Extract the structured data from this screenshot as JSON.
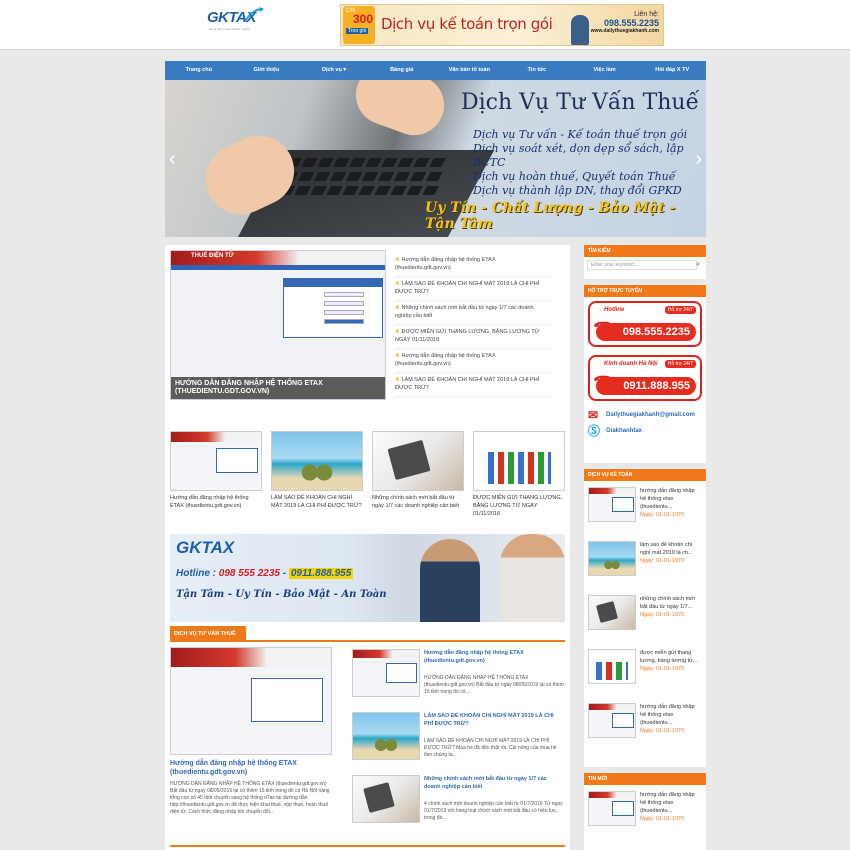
{
  "header": {
    "logo_text": "GKTAX",
    "logo_tagline": "Đồng hành cùng doanh nghiệp",
    "ad": {
      "badge_chi": "Chỉ",
      "badge_num": "300",
      "badge_sub": "Trọn gói",
      "title": "Dịch vụ kế toán trọn gói",
      "contact_label": "Liên hệ:",
      "phone": "098.555.2235",
      "site": "www.dailythuegiakhanh.com"
    }
  },
  "nav": [
    "Trang chủ",
    "Giới thiệu",
    "Dịch vụ ▾",
    "Bảng giá",
    "Văn bản tổ toán",
    "Tin tức",
    "Việc làm",
    "Hỏi đáp X TV"
  ],
  "slider": {
    "title": "Dịch Vụ Tư Vấn Thuế",
    "lines": [
      "Dịch vụ Tư vấn - Kế toán thuế trọn gói",
      "Dịch vụ soát xét, dọn dẹp sổ sách, lập BCTC",
      "Dịch vụ hoàn thuế, Quyết toán Thuế",
      "Dịch vụ thành lập DN, thay đổi GPKD"
    ],
    "tagline": "Uy Tín - Chất Lượng - Bảo Mật - Tận Tâm",
    "prev": "‹",
    "next": "›"
  },
  "feature": {
    "tax_header": "THUẾ ĐIỆN TỬ",
    "caption": "HƯỚNG DẪN ĐĂNG NHẬP HỆ THỐNG ETAX (THUEDIENTU.GDT.GOV.VN)"
  },
  "latest": [
    "Hướng dẫn đăng nhập hệ thống ETAX (thuedientu.gdt.gov.vn)",
    "LÀM SAO ĐỂ KHOẢN CHI NGHỈ MÁT 2019 LÀ CHI PHÍ ĐƯỢC TRỪ?",
    "Những chính sách mới bắt đầu từ ngày 1/7 các doanh nghiệp cần biết",
    "ĐƯỢC MIỄN GỬI THANG LƯƠNG, BẢNG LƯƠNG TỪ NGÀY 01/11/2018",
    "Hướng dẫn đăng nhập hệ thống ETAX (thuedientu.gdt.gov.vn)",
    "LÀM SAO ĐỂ KHOẢN CHI NGHỈ MÁT 2019 LÀ CHI PHÍ ĐƯỢC TRỪ?"
  ],
  "thumbs": [
    "Hướng dẫn đăng nhập hệ thống ETAX (thuedientu.gdt.gov.vn)",
    "LÀM SAO ĐỂ KHOẢN CHI NGHỈ MÁT 2019 LÀ CHI PHÍ ĐƯỢC TRỪ?",
    "Những chính sách mới bắt đầu từ ngày 1/7 các doanh nghiệp cần biết",
    "ĐƯỢC MIỄN GỬI THANG LƯƠNG, BẢNG LƯƠNG TỪ NGÀY 01/11/2018"
  ],
  "promo": {
    "logo": "GKTAX",
    "hotline_label": "Hotline :",
    "hotline_1": "098 555 2235",
    "hotline_2": "0911.888.955",
    "slogan": "Tận Tâm - Uy Tín - Bảo Mật - An Toàn"
  },
  "section": {
    "label": "DỊCH VỤ TƯ VẤN THUẾ",
    "big": {
      "title": "Hướng dẫn đăng nhập hệ thống ETAX (thuedientu.gdt.gov.vn)",
      "desc": "HƯỚNG DẪN ĐĂNG NHẬP HỆ THỐNG ETAX (thuedientu.gdt.gov.vn) Bắt đầu từ ngày 08/05/2019 lại có thêm 15 tỉnh trong đó có Hà Nội nâng tổng con số 45 tỉnh chuyển sang hệ thống eTax tại đường dẫn http://thuedientu.gdt.gov.vn để thực hiện khai thuế, nộp thuế, hoàn thuế điện tử. Cách thức đăng nhập khi chuyển đổi..."
    },
    "small": [
      {
        "title": "Hướng dẫn đăng nhập hệ thống ETAX (thuedientu.gdt.gov.vn)",
        "desc": "HƯỚNG DẪN ĐĂNG NHẬP HỆ THỐNG ETAX (thuedientu.gdt.gov.vn) Bắt đầu từ ngày 08/05/2019 lại có thêm 15 tỉnh trong đó có..."
      },
      {
        "title": "LÀM SAO ĐỂ KHOẢN CHI NGHỈ MÁT 2019 LÀ CHI PHÍ ĐƯỢC TRỪ?",
        "desc": "LÀM SAO ĐỂ KHOẢN CHI NGHỈ MÁT 2019 LÀ CHI PHÍ ĐƯỢC TRỪ? Mùa hè đã đến thật rồi. Cái nóng của mùa hè làm chúng ta..."
      },
      {
        "title": "Những chính sách mới bắt đầu từ ngày 1/7 các doanh nghiệp cần biết",
        "desc": "4 chính sách mới doanh nghiệp cần biết từ 01/7/2019 Từ ngày 01/7/2019 với hàng loạt chính sách mới bắt đầu có hiệu lực, trong đó..."
      }
    ]
  },
  "sidebar": {
    "search_title": "TÌM KIẾM",
    "search_placeholder": "Enter your keyword...",
    "support_title": "HỖ TRỢ TRỰC TUYẾN",
    "hotline_label": "Hotline",
    "hotline_phone": "098.555.2235",
    "sales_label": "Kinh doanh Hà Nội",
    "sales_phone": "0911.888.955",
    "support_badge": "Hỗ trợ 24/7",
    "email": "Dailythuegiakhanh@gmail.com",
    "skype": "Giakhanhtax",
    "accounting_title": "DỊCH VỤ KẾ TOÁN",
    "accounting_posts": [
      {
        "title": "hướng dẫn đăng nhập hệ thống etax (thuedientu...",
        "date": "Ngày: 01-01-1970"
      },
      {
        "title": "làm sao để khoản chi nghỉ mát 2019 là ch...",
        "date": "Ngày: 01-01-1970"
      },
      {
        "title": "những chính sách mới bắt đầu từ ngày 1/7...",
        "date": "Ngày: 01-01-1970"
      },
      {
        "title": "được miễn gửi thang lương, bảng lương từ...",
        "date": "Ngày: 01-01-1970"
      },
      {
        "title": "hướng dẫn đăng nhập hệ thống etax (thuedientu...",
        "date": "Ngày: 01-01-1970"
      }
    ],
    "news_title": "TIN MỚI",
    "news_posts": [
      {
        "title": "hướng dẫn đăng nhập hệ thống etax (thuedientu...",
        "date": "Ngày: 01-01-1970"
      }
    ]
  }
}
